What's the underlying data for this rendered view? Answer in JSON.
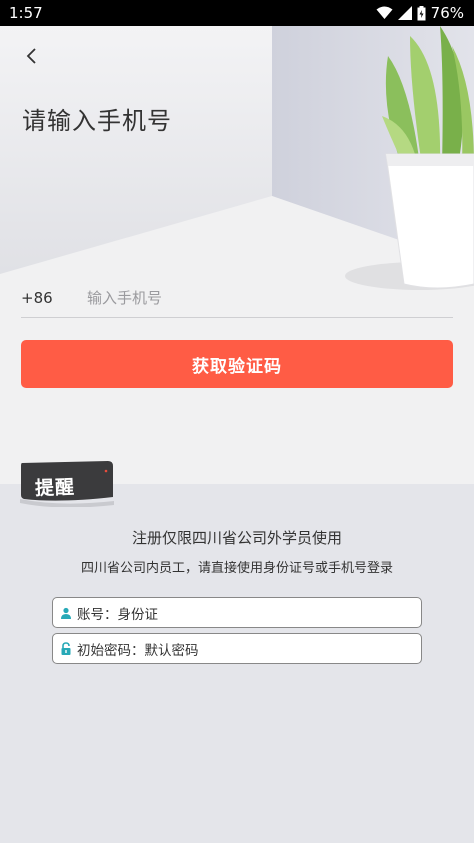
{
  "status_bar": {
    "time": "1:57",
    "battery": "76%",
    "icons": [
      "wifi-icon",
      "signal-icon",
      "battery-icon"
    ]
  },
  "header": {
    "back_icon": "back-chevron-icon",
    "title": "请输入手机号"
  },
  "phone": {
    "country_code": "+86",
    "placeholder": "输入手机号",
    "value": ""
  },
  "get_code_button": {
    "label": "获取验证码"
  },
  "reminder": {
    "badge_label": "提醒",
    "line1": "注册仅限四川省公司外学员使用",
    "line2": "四川省公司内员工，请直接使用身份证号或手机号登录",
    "account": {
      "icon": "person-icon",
      "text": "账号：身份证"
    },
    "password": {
      "icon": "lock-icon",
      "text": "初始密码：默认密码"
    }
  },
  "colors": {
    "accent": "#ff5c45",
    "icon_teal": "#27a9b7",
    "background": "#e4e5ea"
  }
}
